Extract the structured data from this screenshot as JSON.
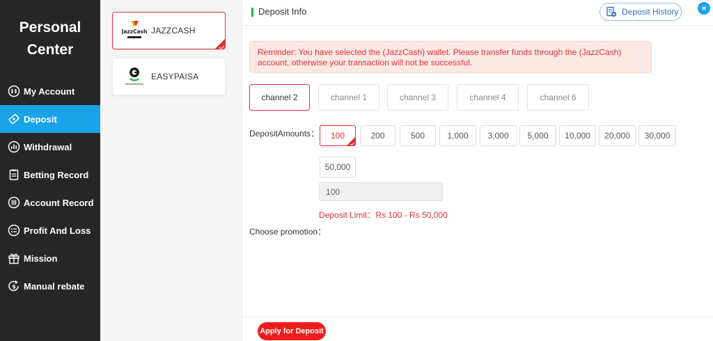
{
  "sidebar": {
    "title_line1": "Personal",
    "title_line2": "Center",
    "items": [
      {
        "label": "My Account",
        "icon": "account-icon"
      },
      {
        "label": "Deposit",
        "icon": "deposit-icon"
      },
      {
        "label": "Withdrawal",
        "icon": "withdrawal-icon"
      },
      {
        "label": "Betting Record",
        "icon": "betting-record-icon"
      },
      {
        "label": "Account Record",
        "icon": "account-record-icon"
      },
      {
        "label": "Profit And Loss",
        "icon": "profit-loss-icon"
      },
      {
        "label": "Mission",
        "icon": "gift-icon"
      },
      {
        "label": "Manual rebate",
        "icon": "rebate-icon"
      }
    ],
    "active_index": 1
  },
  "wallets": [
    {
      "name": "JAZZCASH",
      "logo_text": "JazzCash",
      "selected": true
    },
    {
      "name": "EASYPAISA",
      "selected": false
    }
  ],
  "header": {
    "title": "Deposit Info",
    "history_label": "Deposit History",
    "close_label": "×"
  },
  "reminder": "Reminder: You have selected the (JazzCash) wallet. Please transfer funds through the (JazzCash) account, otherwise your transaction will not be successful.",
  "channels": [
    {
      "label": "channel 2",
      "active": true
    },
    {
      "label": "channel 1",
      "active": false
    },
    {
      "label": "channel 3",
      "active": false
    },
    {
      "label": "channel  4",
      "active": false
    },
    {
      "label": "channel 6",
      "active": false
    }
  ],
  "deposit": {
    "amounts_label": "DepositAmounts：",
    "amounts": [
      "100",
      "200",
      "500",
      "1,000",
      "3,000",
      "5,000",
      "10,000",
      "20,000",
      "30,000",
      "50,000"
    ],
    "selected_amount": "100",
    "input_value": "100",
    "limit_text": "Deposit Limit：Rs  100  - Rs  50,000",
    "promotion_label": "Choose promotion："
  },
  "footer": {
    "apply_label": "Apply for Deposit"
  },
  "colors": {
    "sidebar_bg": "#262626",
    "active_blue": "#1aa3e8",
    "accent_red": "#e0303a",
    "apply_red": "#f01c1c",
    "header_green": "#22b24c"
  }
}
